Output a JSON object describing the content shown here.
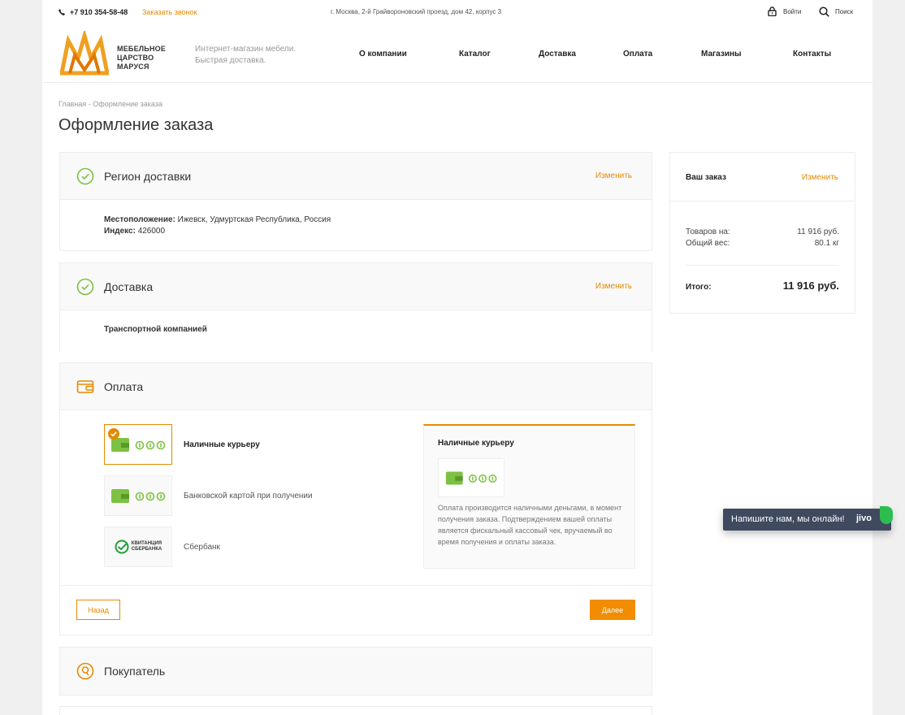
{
  "topbar": {
    "phone": "+7 910 354-58-48",
    "callback": "Заказать звонок",
    "address": "г. Москва, 2-й Грайвороновский проезд, дом 42, корпус 3",
    "login": "Войти",
    "search": "Поиск"
  },
  "header": {
    "logo_line1": "МЕБЕЛЬНОЕ",
    "logo_line2": "ЦАРСТВО",
    "logo_line3": "МАРУСЯ",
    "tagline_line1": "Интернет-магазин мебели.",
    "tagline_line2": "Быстрая доставка.",
    "nav": [
      "О компании",
      "Каталог",
      "Доставка",
      "Оплата",
      "Магазины",
      "Контакты"
    ]
  },
  "breadcrumb": {
    "home": "Главная",
    "separator": "-",
    "current": "Оформление заказа"
  },
  "page_title": "Оформление заказа",
  "region": {
    "title": "Регион доставки",
    "change": "Изменить",
    "location_label": "Местоположение:",
    "location_value": "Ижевск, Удмуртская Республика, Россия",
    "index_label": "Индекс:",
    "index_value": "426000"
  },
  "delivery": {
    "title": "Доставка",
    "change": "Изменить",
    "method": "Транспортной компанией"
  },
  "payment": {
    "title": "Оплата",
    "options": [
      {
        "label": "Наличные курьеру"
      },
      {
        "label": "Банковской картой при получении"
      },
      {
        "label": "Сбербанк",
        "logo_line1": "КВИТАНЦИЯ",
        "logo_line2": "СБЕРБАНКА"
      }
    ],
    "detail_title": "Наличные курьеру",
    "detail_desc": "Оплата производится наличными деньгами, в момент получения заказа. Подтверждением вашей оплаты является фискальный кассовый чек, вручаемый во время получения и оплаты заказа.",
    "back": "Назад",
    "next": "Далее"
  },
  "buyer": {
    "title": "Покупатель"
  },
  "order": {
    "title": "Ваш заказ",
    "change": "Изменить",
    "goods_label": "Товаров на:",
    "goods_value": "11 916 руб.",
    "weight_label": "Общий вес:",
    "weight_value": "80.1 кг",
    "total_label": "Итого:",
    "total_value": "11 916 руб."
  },
  "chat": {
    "text": "Напишите нам, мы онлайн!",
    "brand": "jivo"
  },
  "colors": {
    "accent": "#e58a00",
    "button": "#f28c00",
    "check": "#7dc142",
    "chat_bg": "#3f4a5f"
  }
}
